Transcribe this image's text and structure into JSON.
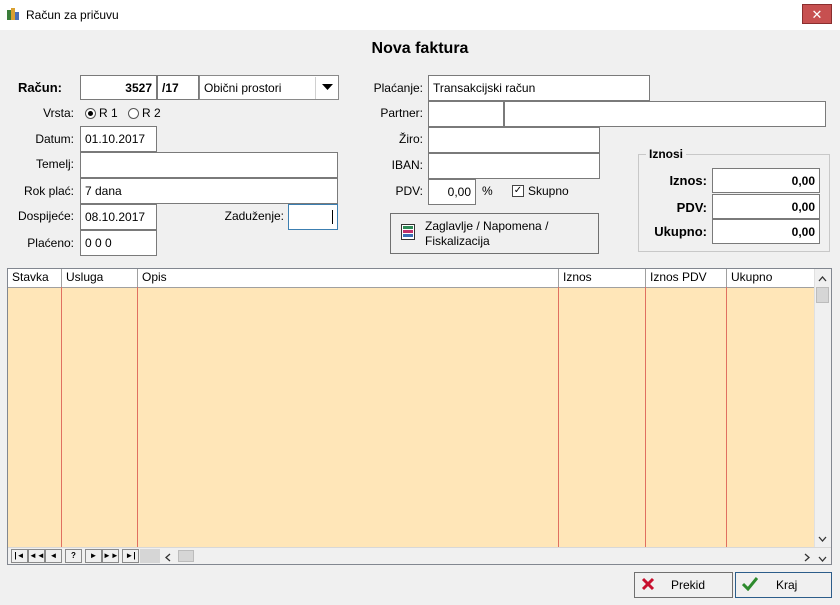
{
  "window": {
    "title": "Račun za pričuvu",
    "close_label": "✕"
  },
  "form_title": "Nova faktura",
  "left": {
    "racun_label": "Račun:",
    "racun_number": "3527",
    "racun_suffix": "/17",
    "category_value": "Obični prostori",
    "vrsta_label": "Vrsta:",
    "r1_label": "R 1",
    "r2_label": "R 2",
    "datum_label": "Datum:",
    "datum_value": "01.10.2017",
    "temelj_label": "Temelj:",
    "temelj_value": "",
    "rok_label": "Rok plać:",
    "rok_value": "7 dana",
    "dospijece_label": "Dospijeće:",
    "dospijece_value": "08.10.2017",
    "zaduzenje_label": "Zaduženje:",
    "zaduzenje_value": "",
    "placeno_label": "Plaćeno:",
    "placeno_value": "0 0  0"
  },
  "right": {
    "placanje_label": "Plaćanje:",
    "placanje_value": "Transakcijski račun",
    "partner_label": "Partner:",
    "partner_code": "",
    "partner_name": "",
    "ziro_label": "Žiro:",
    "ziro_value": "",
    "iban_label": "IBAN:",
    "iban_value": "",
    "pdv_label": "PDV:",
    "pdv_value": "0,00",
    "pdv_unit": "%",
    "skupno_label": "Skupno",
    "zaglavlje_line1": "Zaglavlje / Napomena /",
    "zaglavlje_line2": "Fiskalizacija"
  },
  "iznosi": {
    "title": "Iznosi",
    "iznos_label": "Iznos:",
    "iznos_value": "0,00",
    "pdv_label": "PDV:",
    "pdv_value": "0,00",
    "ukupno_label": "Ukupno:",
    "ukupno_value": "0,00"
  },
  "grid": {
    "columns": [
      "Stavka",
      "Usluga",
      "Opis",
      "Iznos",
      "Iznos PDV",
      "Ukupno"
    ],
    "rows": [],
    "nav": [
      "|◄",
      "◄◄",
      "◄",
      "?",
      "►",
      "►►",
      "►|"
    ]
  },
  "buttons": {
    "prekid": "Prekid",
    "kraj": "Kraj"
  },
  "colors": {
    "grid_bg": "#ffe6b8",
    "grid_lines": "#e07060",
    "close_btn": "#c75050"
  }
}
